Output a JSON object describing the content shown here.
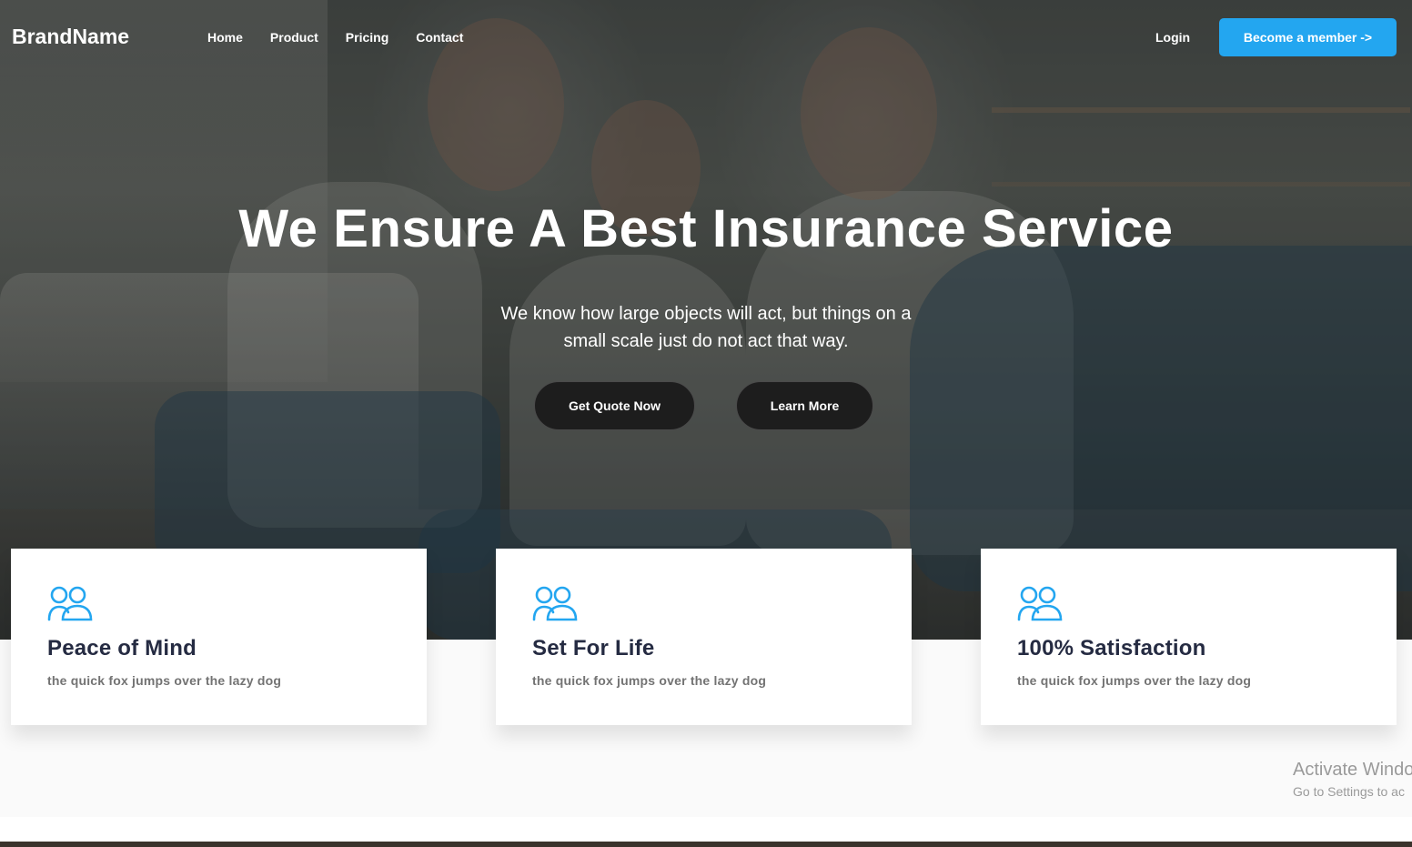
{
  "nav": {
    "brand": "BrandName",
    "links": [
      "Home",
      "Product",
      "Pricing",
      "Contact"
    ],
    "login": "Login",
    "cta": "Become a member ->"
  },
  "hero": {
    "title": "We Ensure A Best Insurance Service",
    "subtitle": "We know how large objects will act, but things on a small scale just do not act that way.",
    "primary_button": "Get Quote Now",
    "secondary_button": "Learn More"
  },
  "features": [
    {
      "icon": "users-icon",
      "title": "Peace of Mind",
      "text": "the quick fox jumps over the lazy dog"
    },
    {
      "icon": "users-icon",
      "title": "Set For Life",
      "text": "the quick fox jumps over the lazy dog"
    },
    {
      "icon": "users-icon",
      "title": "100% Satisfaction",
      "text": "the quick fox jumps over the lazy dog"
    }
  ],
  "watermark": {
    "line1": "Activate Windo",
    "line2": "Go to Settings to ac"
  },
  "colors": {
    "accent": "#23a6f0",
    "heading": "#252b42",
    "muted": "#737373"
  }
}
